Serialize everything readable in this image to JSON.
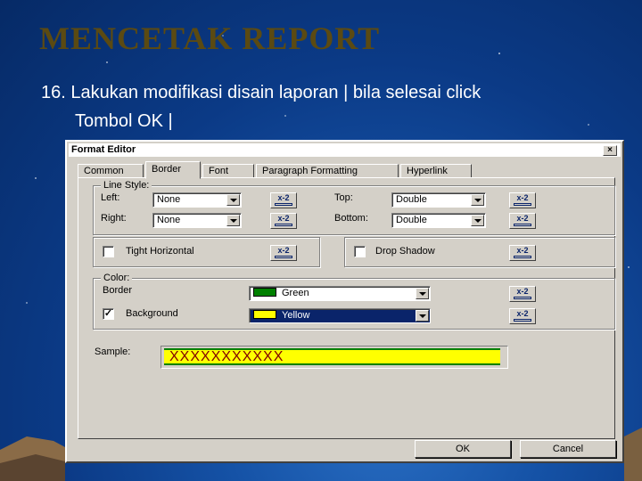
{
  "slide": {
    "title": "MENCETAK  REPORT",
    "line1": "16. Lakukan modifikasi disain laporan | bila selesai click",
    "line2": "Tombol OK |"
  },
  "dialog": {
    "title": "Format Editor",
    "close": "×",
    "tabs": [
      "Common",
      "Border",
      "Font",
      "Paragraph Formatting",
      "Hyperlink"
    ],
    "active_tab": "Border",
    "line_style": {
      "legend": "Line Style:",
      "left_label": "Left:",
      "left_value": "None",
      "right_label": "Right:",
      "right_value": "None",
      "top_label": "Top:",
      "top_value": "Double",
      "bottom_label": "Bottom:",
      "bottom_value": "Double"
    },
    "tight_horizontal": "Tight Horizontal",
    "drop_shadow": "Drop Shadow",
    "color": {
      "legend": "Color:",
      "border_label": "Border",
      "border_value": "Green",
      "border_color": "#008000",
      "background_label": "Background",
      "background_value": "Yellow",
      "background_color": "#ffff00",
      "background_checked": true,
      "check_mark": "✓"
    },
    "formula_button": "x-2",
    "sample_label": "Sample:",
    "sample_text": "XXXXXXXXXXX",
    "ok": "OK",
    "cancel": "Cancel"
  }
}
